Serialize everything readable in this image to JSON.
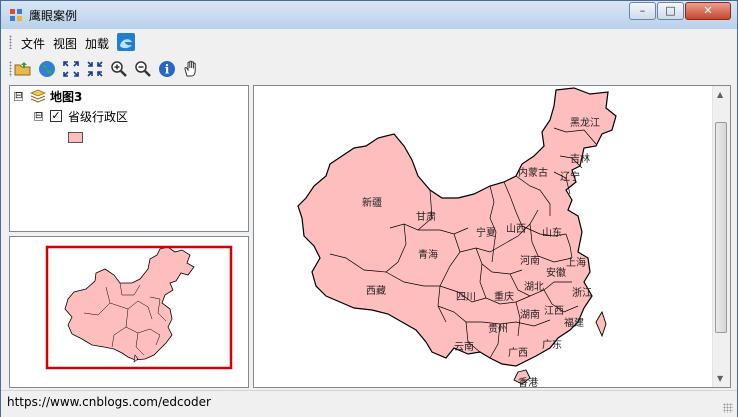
{
  "window": {
    "title": "鹰眼案例",
    "minimize": "–",
    "maximize": "□",
    "close": "✕"
  },
  "menu": {
    "items": [
      "文件",
      "视图",
      "加载"
    ]
  },
  "toolbar": {
    "buttons": [
      "open-folder-icon",
      "globe-icon",
      "full-extent-icon",
      "fixed-zoom-icon",
      "zoom-in-icon",
      "zoom-out-icon",
      "identify-icon",
      "pan-hand-icon"
    ]
  },
  "toc": {
    "map_name": "地图3",
    "layer_name": "省级行政区",
    "layer_checked": true,
    "expander": "⊟",
    "symbol_color": "#ffbebe"
  },
  "map": {
    "fill_color": "#ffbebe",
    "extent_box_color": "#d40000",
    "province_labels": [
      "黑龙江",
      "吉林",
      "辽宁",
      "内蒙古",
      "新疆",
      "甘肃",
      "宁夏",
      "山西",
      "山东",
      "青海",
      "河南",
      "上海",
      "安徽",
      "西藏",
      "四川",
      "湖北",
      "重庆",
      "江西",
      "浙江",
      "湖南",
      "福建",
      "贵州",
      "云南",
      "广西",
      "广东",
      "香港"
    ]
  },
  "status": {
    "url": "https://www.cnblogs.com/edcoder"
  }
}
